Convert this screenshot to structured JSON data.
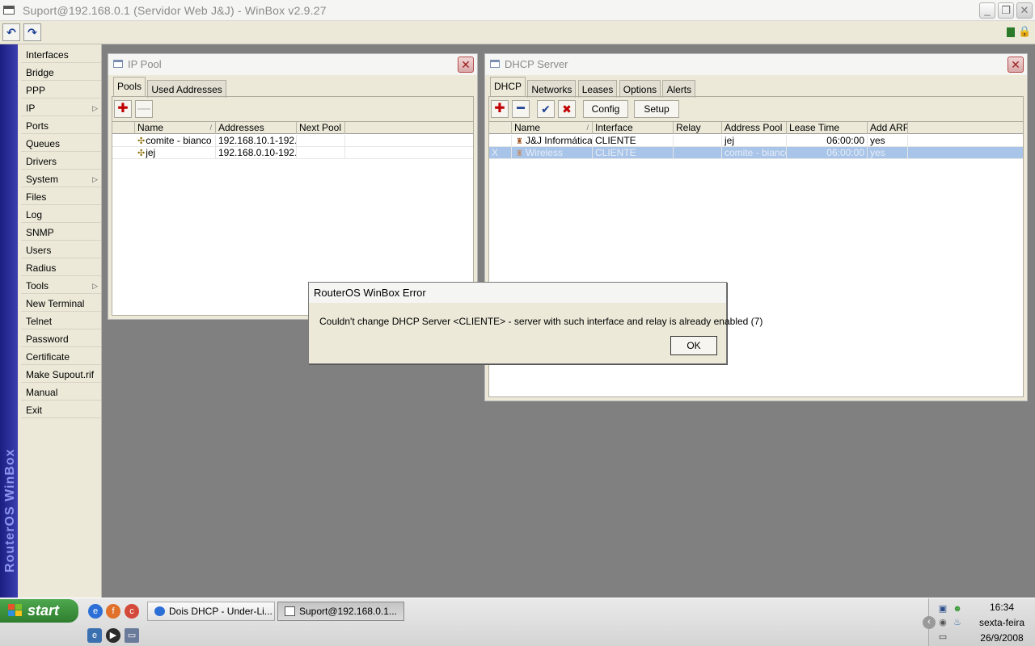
{
  "window": {
    "title": "Suport@192.168.0.1 (Servidor Web J&J) - WinBox v2.9.27",
    "minimize": "_",
    "maximize": "❐",
    "close": "✕"
  },
  "toolbar": {
    "undo_icon": "↶",
    "redo_icon": "↷",
    "lock_icon": "🔒"
  },
  "sidebar": {
    "brand": "RouterOS WinBox",
    "items": [
      {
        "label": "Interfaces",
        "submenu": false
      },
      {
        "label": "Bridge",
        "submenu": false
      },
      {
        "label": "PPP",
        "submenu": false
      },
      {
        "label": "IP",
        "submenu": true
      },
      {
        "label": "Ports",
        "submenu": false
      },
      {
        "label": "Queues",
        "submenu": false
      },
      {
        "label": "Drivers",
        "submenu": false
      },
      {
        "label": "System",
        "submenu": true
      },
      {
        "label": "Files",
        "submenu": false
      },
      {
        "label": "Log",
        "submenu": false
      },
      {
        "label": "SNMP",
        "submenu": false
      },
      {
        "label": "Users",
        "submenu": false
      },
      {
        "label": "Radius",
        "submenu": false
      },
      {
        "label": "Tools",
        "submenu": true
      },
      {
        "label": "New Terminal",
        "submenu": false
      },
      {
        "label": "Telnet",
        "submenu": false
      },
      {
        "label": "Password",
        "submenu": false
      },
      {
        "label": "Certificate",
        "submenu": false
      },
      {
        "label": "Make Supout.rif",
        "submenu": false
      },
      {
        "label": "Manual",
        "submenu": false
      },
      {
        "label": "Exit",
        "submenu": false
      }
    ],
    "submenu_arrow": "▷"
  },
  "ip_pool": {
    "title": "IP Pool",
    "close": "✕",
    "tabs": [
      "Pools",
      "Used Addresses"
    ],
    "active_tab": 0,
    "add_icon": "✚",
    "remove_icon": "—",
    "columns": [
      "Name",
      "Addresses",
      "Next Pool"
    ],
    "sort_mark": "/",
    "row_icon": "✣",
    "rows": [
      {
        "name": "comite - bianco",
        "addresses": "192.168.10.1-192...",
        "next_pool": ""
      },
      {
        "name": "jej",
        "addresses": "192.168.0.10-192...",
        "next_pool": ""
      }
    ]
  },
  "dhcp_server": {
    "title": "DHCP Server",
    "close": "✕",
    "tabs": [
      "DHCP",
      "Networks",
      "Leases",
      "Options",
      "Alerts"
    ],
    "active_tab": 0,
    "add_icon": "✚",
    "remove_icon": "━",
    "enable_icon": "✔",
    "disable_icon": "✖",
    "config_label": "Config",
    "setup_label": "Setup",
    "columns": [
      "Name",
      "Interface",
      "Relay",
      "Address Pool",
      "Lease Time",
      "Add ARP"
    ],
    "sort_mark": "/",
    "row_icon": "♜",
    "rows": [
      {
        "flag": "",
        "name": "J&J Informática",
        "interface": "CLIENTE",
        "relay": "",
        "address_pool": "jej",
        "lease_time": "06:00:00",
        "add_arp": "yes",
        "selected": false
      },
      {
        "flag": "X",
        "name": "Wireless",
        "interface": "CLIENTE",
        "relay": "",
        "address_pool": "comite - bianco",
        "lease_time": "06:00:00",
        "add_arp": "yes",
        "selected": true
      }
    ]
  },
  "error_dialog": {
    "title": "RouterOS WinBox Error",
    "message": "Couldn't change DHCP Server <CLIENTE> - server with such interface and relay is already enabled (7)",
    "ok_label": "OK"
  },
  "taskbar": {
    "start_label": "start",
    "tasks": [
      {
        "label": "Dois DHCP - Under-Li...",
        "active": false
      },
      {
        "label": "Suport@192.168.0.1...",
        "active": true
      }
    ],
    "clock": {
      "time": "16:34",
      "day": "sexta-feira",
      "date": "26/9/2008"
    }
  },
  "colors": {
    "accent_sidebar": "#2a2f9a",
    "selected_row": "#a8c4e8",
    "start_green": "#3a933a",
    "close_red": "#9a2020"
  }
}
